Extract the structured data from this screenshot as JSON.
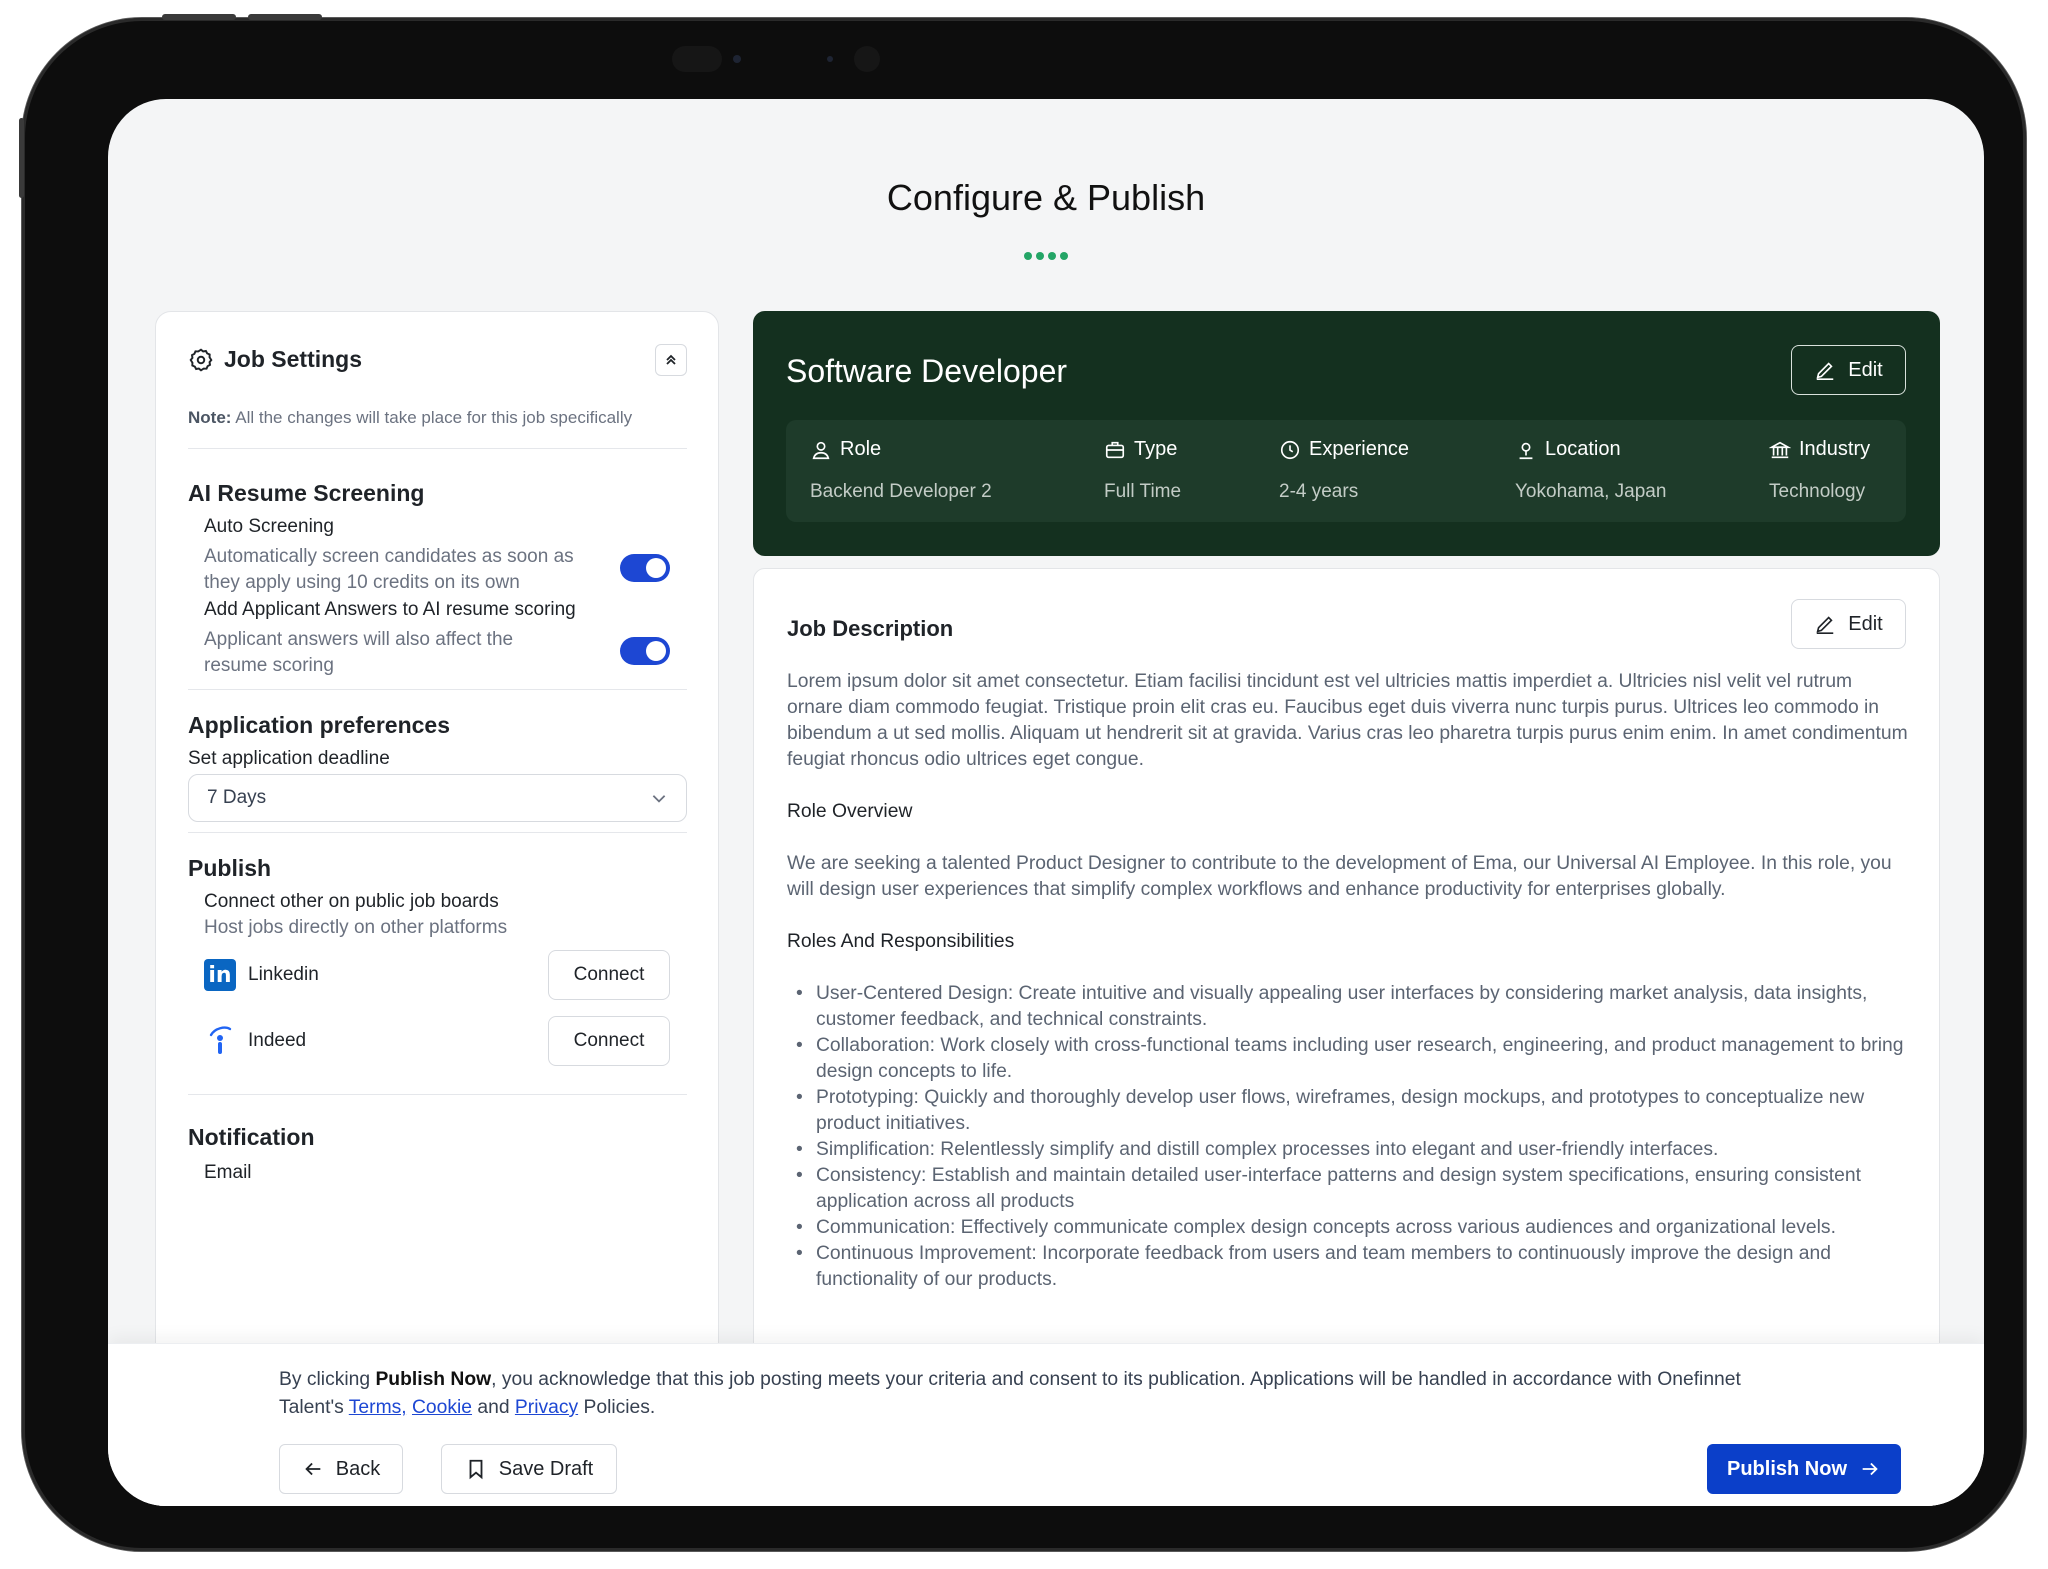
{
  "page": {
    "title": "Configure & Publish"
  },
  "settings": {
    "title": "Job Settings",
    "note_label": "Note:",
    "note_text": " All the changes will take place for this job specifically",
    "ai_screening": {
      "title": "AI Resume Screening",
      "auto_title": "Auto Screening",
      "auto_desc": "Automatically screen candidates as soon as they apply using 10 credits on its own",
      "auto_on": true,
      "answers_title": "Add Applicant Answers to AI resume scoring",
      "answers_desc": "Applicant answers will also affect the resume scoring",
      "answers_on": true
    },
    "preferences": {
      "title": "Application preferences",
      "deadline_label": "Set application deadline",
      "deadline_value": "7 Days"
    },
    "publish": {
      "title": "Publish",
      "connect_title": "Connect other on public job boards",
      "connect_desc": "Host jobs directly on other platforms",
      "boards": [
        {
          "name": "Linkedin",
          "button": "Connect",
          "icon": "linkedin-icon"
        },
        {
          "name": "Indeed",
          "button": "Connect",
          "icon": "indeed-icon"
        }
      ]
    },
    "notification": {
      "title": "Notification",
      "email_label": "Email"
    }
  },
  "job": {
    "title": "Software Developer",
    "edit_label": "Edit",
    "meta": [
      {
        "label": "Role",
        "value": "Backend Developer 2",
        "icon": "user-icon"
      },
      {
        "label": "Type",
        "value": "Full Time",
        "icon": "briefcase-icon"
      },
      {
        "label": "Experience",
        "value": "2-4 years",
        "icon": "clock-icon"
      },
      {
        "label": "Location",
        "value": "Yokohama, Japan",
        "icon": "location-pin-icon"
      },
      {
        "label": "Industry",
        "value": "Technology",
        "icon": "bank-icon"
      }
    ]
  },
  "description": {
    "title": "Job Description",
    "edit_label": "Edit",
    "intro": "Lorem ipsum dolor sit amet consectetur. Etiam facilisi tincidunt est vel ultricies mattis imperdiet a. Ultricies nisl velit vel rutrum ornare diam commodo feugiat. Tristique proin elit cras eu. Faucibus eget duis viverra nunc turpis purus. Ultrices leo commodo in bibendum a ut sed mollis. Aliquam ut hendrerit sit at gravida. Varius cras leo pharetra turpis purus enim enim. In amet condimentum feugiat rhoncus odio ultrices eget congue.",
    "overview_heading": "Role Overview",
    "overview": "We are seeking a talented Product Designer to contribute to the development of Ema, our Universal AI Employee. In this role, you will design user experiences that simplify complex workflows and enhance productivity for enterprises globally.",
    "responsibilities_heading": "Roles And Responsibilities",
    "responsibilities": [
      "User-Centered Design: Create intuitive and visually appealing user interfaces by considering market analysis, data insights, customer feedback, and technical constraints.",
      "Collaboration: Work closely with cross-functional teams including user research, engineering, and product management to bring design concepts to life.",
      "Prototyping: Quickly and thoroughly develop user flows, wireframes, design mockups, and prototypes to conceptualize new product initiatives.",
      "Simplification: Relentlessly simplify and distill complex processes into elegant and user-friendly interfaces.",
      "Consistency: Establish and maintain detailed user-interface patterns and design system specifications, ensuring consistent application across all products",
      "Communication: Effectively communicate complex design concepts across various audiences and organizational levels.",
      "Continuous Improvement: Incorporate feedback from users and team members to continuously improve the design and functionality of our products."
    ]
  },
  "footer": {
    "consent_pre": "By clicking ",
    "consent_bold": "Publish Now",
    "consent_mid": ", you acknowledge that this job posting meets your criteria and consent to its publication. Applications will be handled in accordance with Onefinnet Talent's ",
    "terms": "Terms,",
    "cookie": "Cookie",
    "and": "and",
    "privacy": "Privacy",
    "policies": "Policies.",
    "back_label": "Back",
    "draft_label": "Save Draft",
    "publish_label": "Publish Now"
  },
  "colors": {
    "accent": "#0b3fc9",
    "dark_header": "#14301f",
    "progress_dot": "#23a566"
  }
}
